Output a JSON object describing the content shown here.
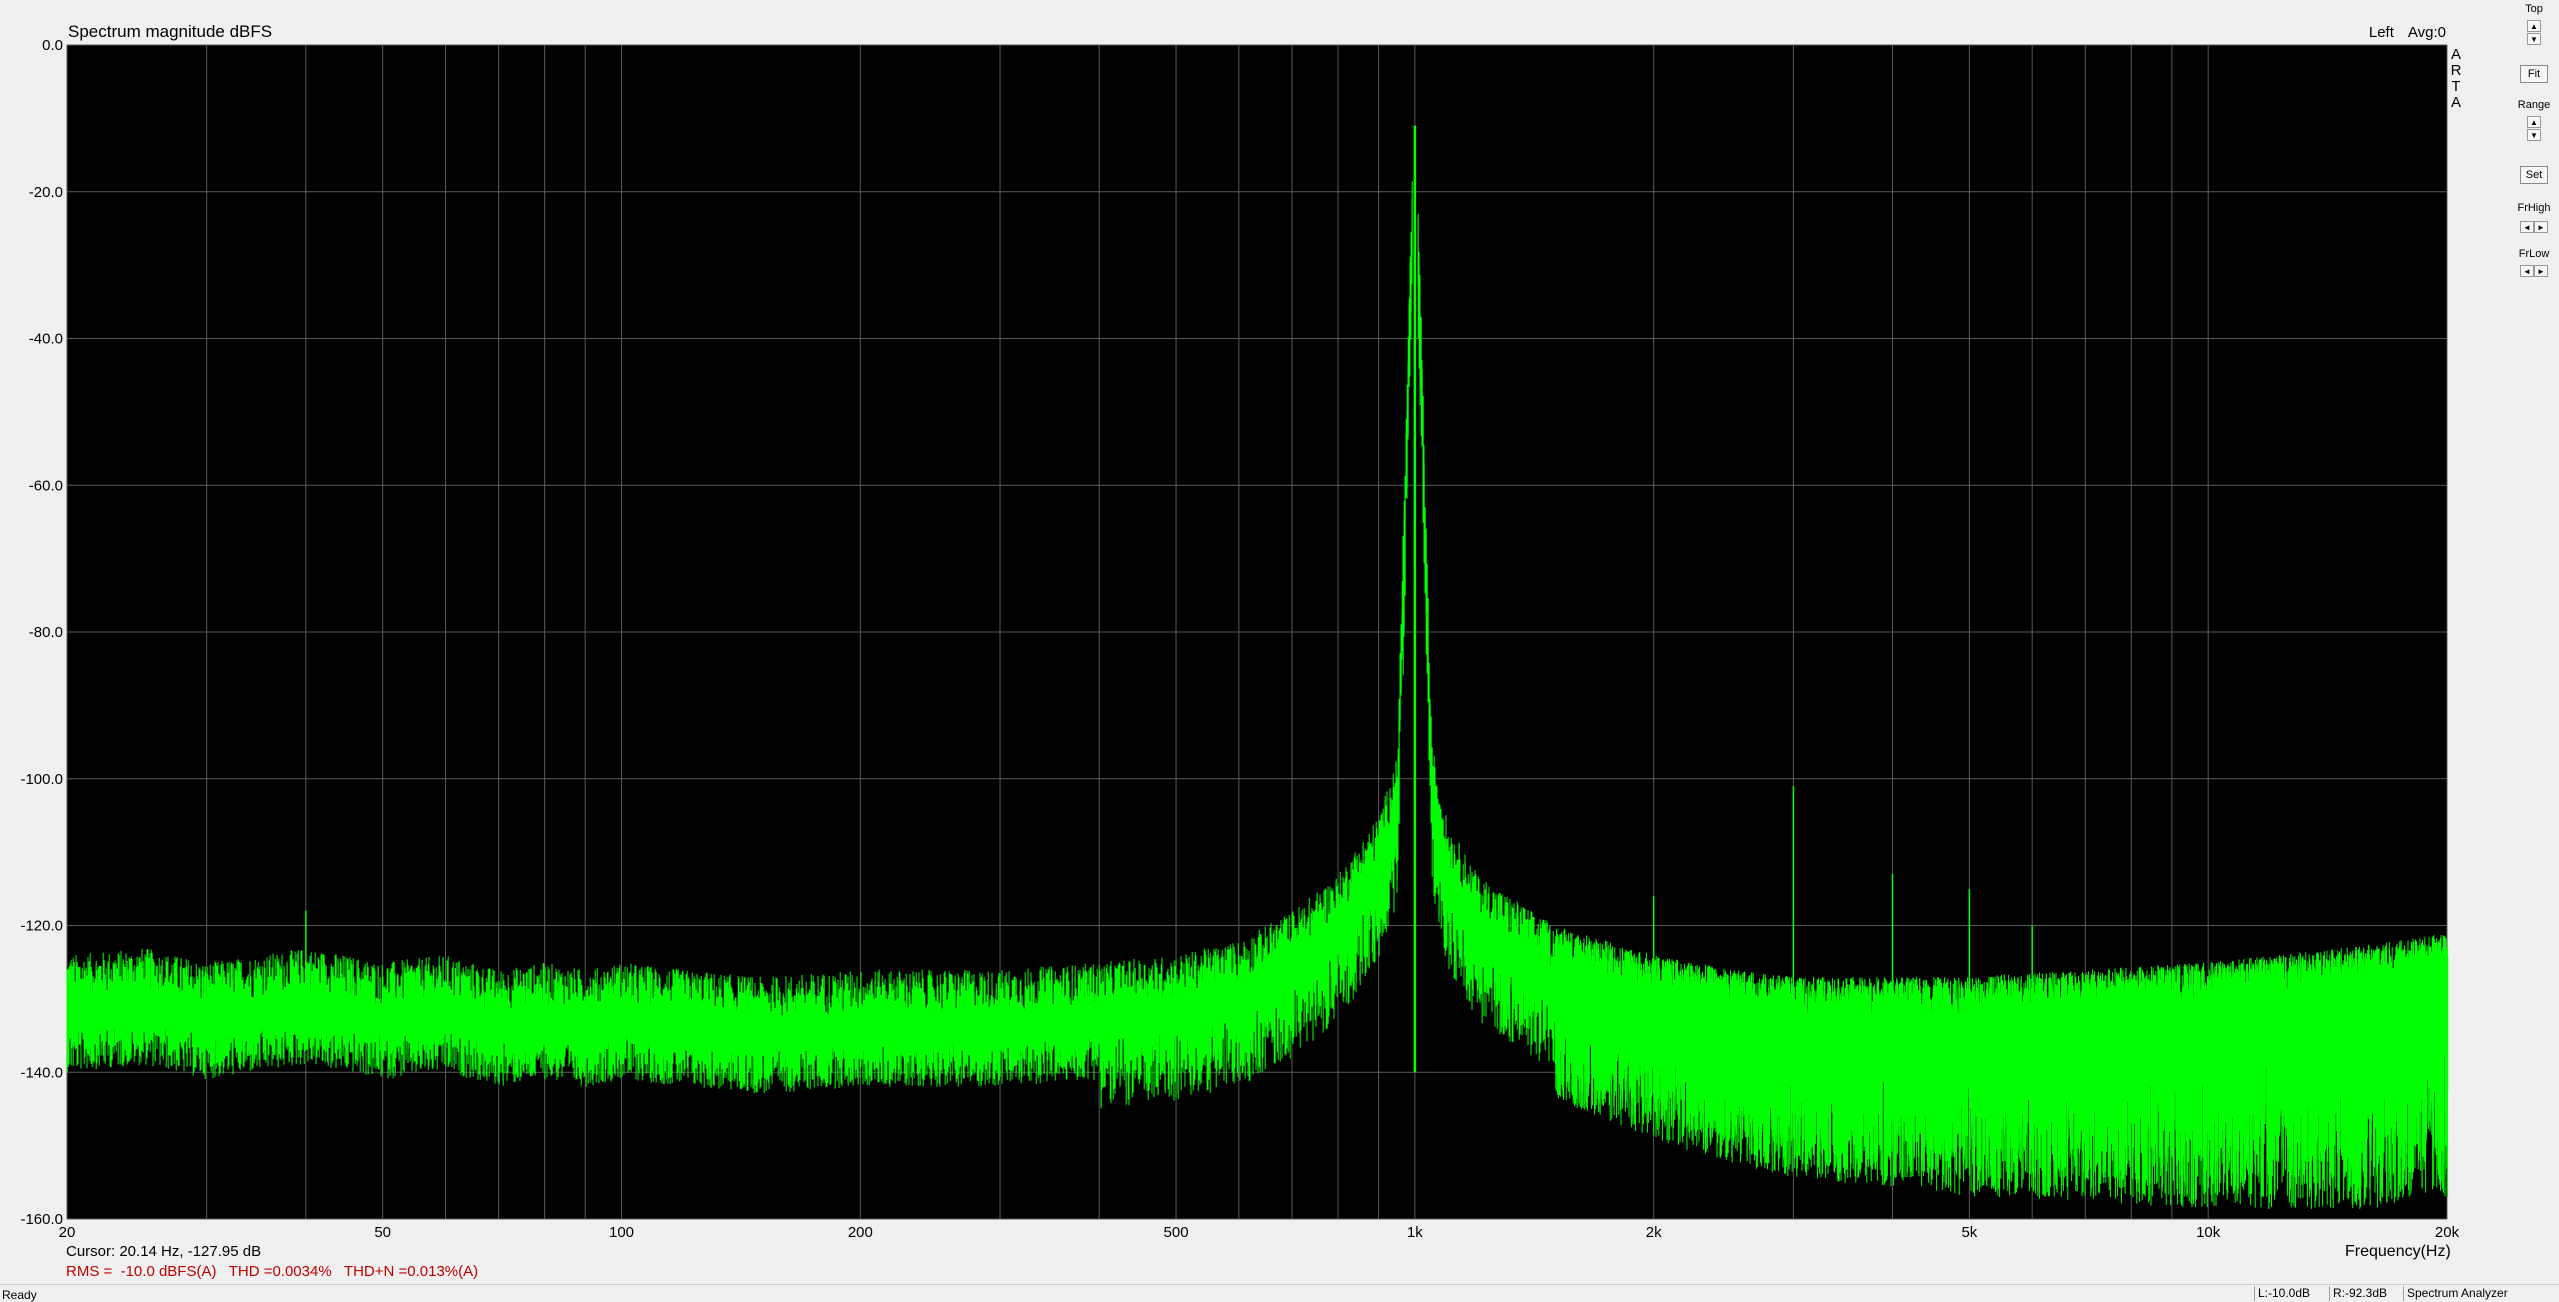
{
  "window": {
    "title": "Spectrum magnitude dBFS",
    "channel": "Left",
    "average": "Avg:0",
    "logo_letters": [
      "A",
      "R",
      "T",
      "A"
    ]
  },
  "colors": {
    "plot_background": "#000000",
    "trace": "#00ff00",
    "grid": "#5a5a5a",
    "measurement_text": "#c00000"
  },
  "chart_data": {
    "type": "line",
    "title": "Spectrum magnitude dBFS",
    "xlabel": "Frequency(Hz)",
    "ylabel": "",
    "x_scale": "log",
    "xlim": [
      20,
      20000
    ],
    "ylim": [
      -160,
      0
    ],
    "grid": true,
    "y_ticks": [
      "0.0",
      "-20.0",
      "-40.0",
      "-60.0",
      "-80.0",
      "-100.0",
      "-120.0",
      "-140.0",
      "-160.0"
    ],
    "x_ticks": [
      {
        "value": 20,
        "label": "20"
      },
      {
        "value": 50,
        "label": "50"
      },
      {
        "value": 100,
        "label": "100"
      },
      {
        "value": 200,
        "label": "200"
      },
      {
        "value": 500,
        "label": "500"
      },
      {
        "value": 1000,
        "label": "1k"
      },
      {
        "value": 2000,
        "label": "2k"
      },
      {
        "value": 5000,
        "label": "5k"
      },
      {
        "value": 10000,
        "label": "10k"
      },
      {
        "value": 20000,
        "label": "20k"
      }
    ],
    "series": [
      {
        "color": "#00ff00",
        "x": [
          20,
          25,
          30,
          35,
          40,
          45,
          50,
          60,
          70,
          80,
          90,
          100,
          120,
          150,
          200,
          250,
          300,
          400,
          500,
          600,
          700,
          800,
          900,
          950,
          1000,
          1050,
          1100,
          1200,
          1500,
          2000,
          2500,
          3000,
          4000,
          5000,
          7000,
          10000,
          15000,
          20000
        ],
        "y": [
          -132,
          -131,
          -133,
          -132,
          -131,
          -132,
          -133,
          -132,
          -134,
          -133,
          -134,
          -133,
          -134,
          -135,
          -134,
          -134,
          -134,
          -133,
          -132,
          -130,
          -126,
          -121,
          -113,
          -105,
          -11,
          -103,
          -114,
          -121,
          -128,
          -132,
          -134,
          -135,
          -135,
          -135,
          -134,
          -133,
          -131,
          -129
        ]
      }
    ],
    "annotations": [
      {
        "x": 40,
        "y": -118
      },
      {
        "x": 1000,
        "y": -51
      },
      {
        "x": 1000,
        "y": -11
      },
      {
        "x": 2000,
        "y": -116
      },
      {
        "x": 3000,
        "y": -101
      },
      {
        "x": 4000,
        "y": -113
      },
      {
        "x": 5000,
        "y": -115
      },
      {
        "x": 6000,
        "y": -120
      }
    ]
  },
  "readouts": {
    "cursor": "Cursor: 20.14 Hz, -127.95 dB",
    "rms": "RMS =  -10.0 dBFS(A)",
    "thd": "THD =0.0034%",
    "thdn": "THD+N =0.013%(A)"
  },
  "controls": {
    "top_label": "Top",
    "fit_button": "Fit",
    "range_label": "Range",
    "set_button": "Set",
    "frhigh_label": "FrHigh",
    "frlow_label": "FrLow",
    "up_glyph": "▲",
    "down_glyph": "▼",
    "left_glyph": "◄",
    "right_glyph": "►"
  },
  "status": {
    "ready": "Ready",
    "left_level": "L:-10.0dB",
    "right_level": "R:-92.3dB",
    "mode": "Spectrum Analyzer"
  }
}
